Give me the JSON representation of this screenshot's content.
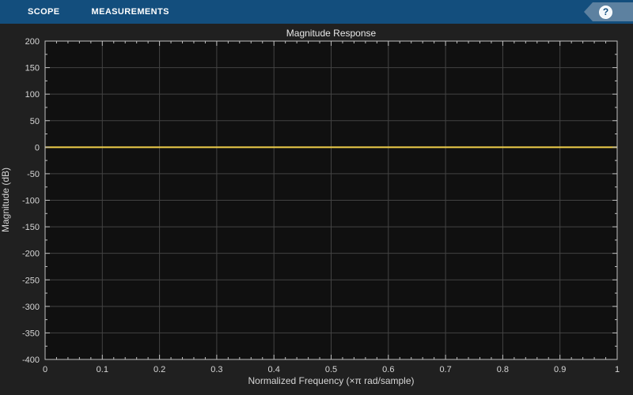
{
  "toolbar": {
    "tabs": [
      {
        "label": "SCOPE"
      },
      {
        "label": "MEASUREMENTS"
      }
    ],
    "help_glyph": "?"
  },
  "colors": {
    "toolbar_bg": "#134e7d",
    "help_tag_bg": "#5d81a0",
    "content_bg": "#202020",
    "plot_bg": "#101010",
    "grid": "#434343",
    "axis": "#c0c0c0",
    "tick_text": "#d6d6d6",
    "line": "#f1d04a"
  },
  "chart_data": {
    "type": "line",
    "title": "Magnitude Response",
    "xlabel": "Normalized Frequency (×π rad/sample)",
    "ylabel": "Magnitude (dB)",
    "xlim": [
      0,
      1
    ],
    "ylim": [
      -400,
      200
    ],
    "x_ticks": [
      0,
      0.1,
      0.2,
      0.3,
      0.4,
      0.5,
      0.6,
      0.7,
      0.8,
      0.9,
      1
    ],
    "x_tick_labels": [
      "0",
      "0.1",
      "0.2",
      "0.3",
      "0.4",
      "0.5",
      "0.6",
      "0.7",
      "0.8",
      "0.9",
      "1"
    ],
    "y_ticks": [
      200,
      150,
      100,
      50,
      0,
      -50,
      -100,
      -150,
      -200,
      -250,
      -300,
      -350,
      -400
    ],
    "y_tick_labels": [
      "200",
      "150",
      "100",
      "50",
      "0",
      "-50",
      "-100",
      "-150",
      "-200",
      "-250",
      "-300",
      "-350",
      "-400"
    ],
    "x_minor_step": 0.02,
    "y_minor_step": 25,
    "grid": true,
    "legend_position": "none",
    "series": [
      {
        "name": "magnitude-response",
        "color": "#f1d04a",
        "x": [
          0,
          1
        ],
        "y": [
          0,
          0
        ]
      }
    ]
  }
}
